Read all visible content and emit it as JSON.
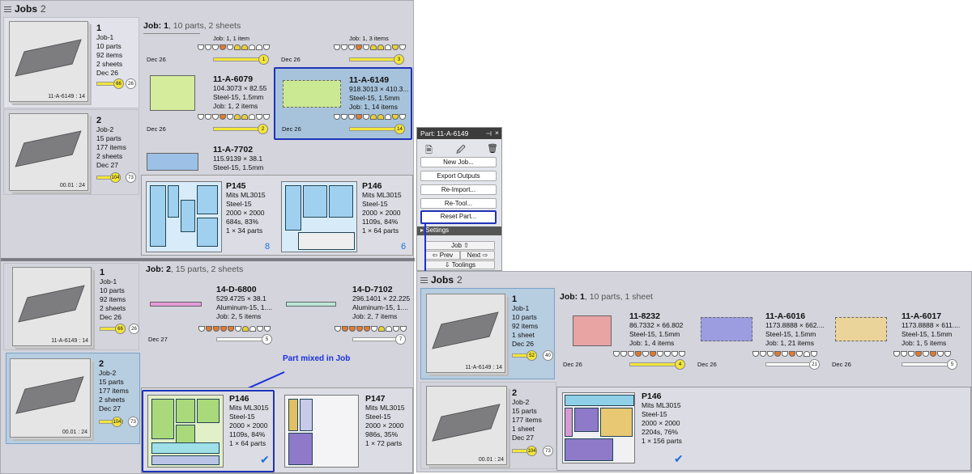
{
  "left": {
    "header": {
      "title": "Jobs",
      "count": "2"
    },
    "top": {
      "jobs": [
        {
          "num": "1",
          "name": "Job-1",
          "parts": "10 parts",
          "items": "92 items",
          "sheets": "2 sheets",
          "date": "Dec 26",
          "progress": "66",
          "total": "26",
          "caption": "11-A-6149 : 14"
        },
        {
          "num": "2",
          "name": "Job-2",
          "parts": "15 parts",
          "items": "177 items",
          "sheets": "2 sheets",
          "date": "Dec 27",
          "progress": "104",
          "total": "73",
          "caption": "00.01 : 24"
        }
      ],
      "title_bold": "Job: 1",
      "title_rest": ", 10 parts, 2 sheets",
      "row1": [
        {
          "date": "Dec 26",
          "job": "Job: 1, 1 item",
          "knob": "1"
        },
        {
          "date": "Dec 26",
          "job": "Job: 1, 3 items",
          "knob": "3"
        }
      ],
      "parts": [
        {
          "id": "11-A-6079",
          "dims": "104.3073 × 82.55",
          "mat": "Steel-15, 1.5mm",
          "job": "Job: 1, 2 items",
          "date": "Dec 26",
          "knob": "2"
        },
        {
          "id": "11-A-6149",
          "dims": "918.3013 × 410.3...",
          "mat": "Steel-15, 1.5mm",
          "job": "Job: 1, 14 items",
          "date": "Dec 26",
          "knob": "14"
        },
        {
          "id": "11-A-7702",
          "dims": "115.9139 × 38.1",
          "mat": "Steel-15, 1.5mm"
        }
      ],
      "sheets": [
        {
          "id": "P145",
          "machine": "Mits ML3015",
          "mat": "Steel-15",
          "size": "2000 × 2000",
          "time": "684s, 83%",
          "qty": "1 × 34 parts",
          "count": "8"
        },
        {
          "id": "P146",
          "machine": "Mits ML3015",
          "mat": "Steel-15",
          "size": "2000 × 2000",
          "time": "1109s, 84%",
          "qty": "1 × 64 parts",
          "count": "6"
        }
      ]
    },
    "bottom": {
      "jobs": [
        {
          "num": "1",
          "name": "Job-1",
          "parts": "10 parts",
          "items": "92 items",
          "sheets": "2 sheets",
          "date": "Dec 26",
          "progress": "66",
          "total": "26",
          "caption": "11-A-6149 : 14"
        },
        {
          "num": "2",
          "name": "Job-2",
          "parts": "15 parts",
          "items": "177 items",
          "sheets": "2 sheets",
          "date": "Dec 27",
          "progress": "104",
          "total": "73",
          "caption": "00.01 : 24"
        }
      ],
      "title_bold": "Job: 2",
      "title_rest": ", 15 parts, 2 sheets",
      "parts": [
        {
          "id": "14-D-6800",
          "dims": "529.4725 × 38.1",
          "mat": "Aluminum-15, 1....",
          "job": "Job: 2, 5 items",
          "date": "Dec 27",
          "knob": "5"
        },
        {
          "id": "14-D-7102",
          "dims": "296.1401 × 22.225",
          "mat": "Aluminum-15, 1....",
          "job": "Job: 2, 7 items",
          "knob": "7"
        }
      ],
      "annotation": "Part mixed in Job",
      "sheets": [
        {
          "id": "P146",
          "machine": "Mits ML3015",
          "mat": "Steel-15",
          "size": "2000 × 2000",
          "time": "1109s, 84%",
          "qty": "1 × 64 parts"
        },
        {
          "id": "P147",
          "machine": "Mits ML3015",
          "mat": "Steel-15",
          "size": "2000 × 2000",
          "time": "986s, 35%",
          "qty": "1 × 72 parts"
        }
      ]
    }
  },
  "popup": {
    "title": "Part: 11-A-6149",
    "buttons": [
      "New Job...",
      "Export Outputs",
      "Re-Import...",
      "Re-Tool...",
      "Reset Part..."
    ],
    "settings": "Settings",
    "nav": {
      "job": "Job",
      "prev": "Prev",
      "next": "Next",
      "toolings": "Toolings"
    }
  },
  "right": {
    "header": {
      "title": "Jobs",
      "count": "2"
    },
    "jobs": [
      {
        "num": "1",
        "name": "Job-1",
        "parts": "10 parts",
        "items": "92 items",
        "sheets": "1 sheet",
        "date": "Dec 26",
        "progress": "52",
        "total": "40",
        "caption": "11-A-6149 : 14"
      },
      {
        "num": "2",
        "name": "Job-2",
        "parts": "15 parts",
        "items": "177 items",
        "sheets": "1 sheet",
        "date": "Dec 27",
        "progress": "104",
        "total": "73",
        "caption": "00.01 : 24"
      }
    ],
    "title_bold": "Job: 1",
    "title_rest": ", 10 parts, 1 sheet",
    "parts": [
      {
        "id": "11-8232",
        "dims": "86.7332 × 66.802",
        "mat": "Steel-15, 1.5mm",
        "job": "Job: 1, 4 items",
        "date": "Dec 26",
        "knob": "4"
      },
      {
        "id": "11-A-6016",
        "dims": "1173.8888 × 662....",
        "mat": "Steel-15, 1.5mm",
        "job": "Job: 1, 21 items",
        "date": "Dec 26",
        "knob": "21"
      },
      {
        "id": "11-A-6017",
        "dims": "1173.8888 × 611....",
        "mat": "Steel-15, 1.5mm",
        "job": "Job: 1, 5 items",
        "date": "Dec 26",
        "knob": "5"
      }
    ],
    "sheet": {
      "id": "P146",
      "machine": "Mits ML3015",
      "mat": "Steel-15",
      "size": "2000 × 2000",
      "time": "2204s, 76%",
      "qty": "1 × 156 parts"
    }
  }
}
